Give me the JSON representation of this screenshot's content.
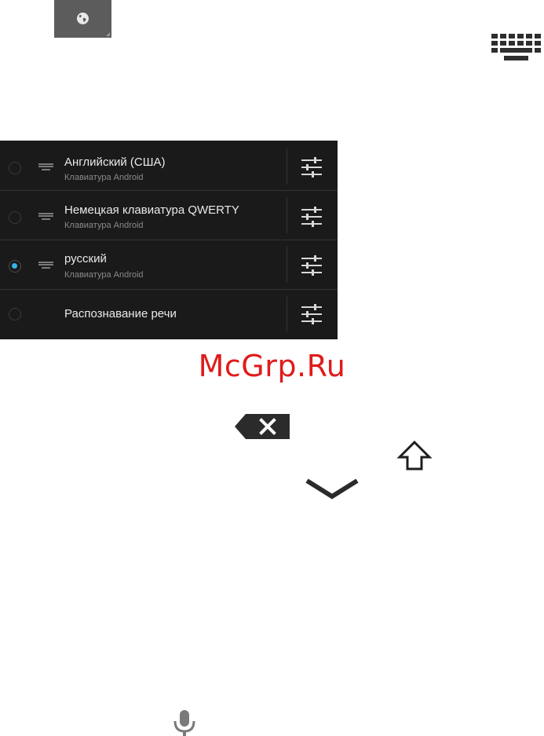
{
  "icons": {
    "globe": "globe-icon",
    "keyboard": "keyboard-icon",
    "backspace": "backspace-icon",
    "shift": "shift-arrow-icon",
    "hide_keyboard": "chevron-down-icon",
    "voice": "microphone-icon",
    "settings": "sliders-settings-icon"
  },
  "colors": {
    "panel_bg": "#1a1a1a",
    "radio_selected": "#33b5e5",
    "watermark": "#e01b1b"
  },
  "ime_picker": {
    "items": [
      {
        "title": "Английский (США)",
        "subtitle": "Клавиатура Android",
        "selected": false,
        "has_keyboard_icon": true
      },
      {
        "title": "Немецкая клавиатура QWERTY",
        "subtitle": "Клавиатура Android",
        "selected": false,
        "has_keyboard_icon": true
      },
      {
        "title": "русский",
        "subtitle": "Клавиатура Android",
        "selected": true,
        "has_keyboard_icon": true
      },
      {
        "title": "Распознавание речи",
        "subtitle": "",
        "selected": false,
        "has_keyboard_icon": false
      }
    ]
  },
  "watermark": {
    "text": "McGrp.Ru"
  }
}
